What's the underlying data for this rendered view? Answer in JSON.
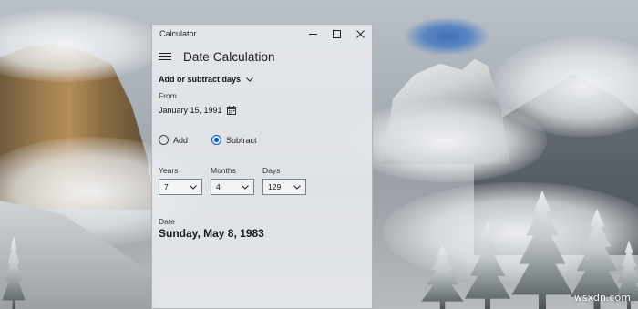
{
  "window": {
    "app_title": "Calculator",
    "mode_title": "Date Calculation"
  },
  "mode_dropdown": {
    "selected": "Add or subtract days"
  },
  "from": {
    "label": "From",
    "date": "January 15, 1991"
  },
  "operation": {
    "options": [
      {
        "label": "Add",
        "selected": false
      },
      {
        "label": "Subtract",
        "selected": true
      }
    ]
  },
  "offsets": {
    "years": {
      "label": "Years",
      "value": "7"
    },
    "months": {
      "label": "Months",
      "value": "4"
    },
    "days": {
      "label": "Days",
      "value": "129"
    }
  },
  "result": {
    "label": "Date",
    "value": "Sunday, May 8, 1983"
  },
  "watermark": "wsxdn.com",
  "colors": {
    "accent": "#0a5fc4",
    "window_bg": "#e8ebee"
  }
}
